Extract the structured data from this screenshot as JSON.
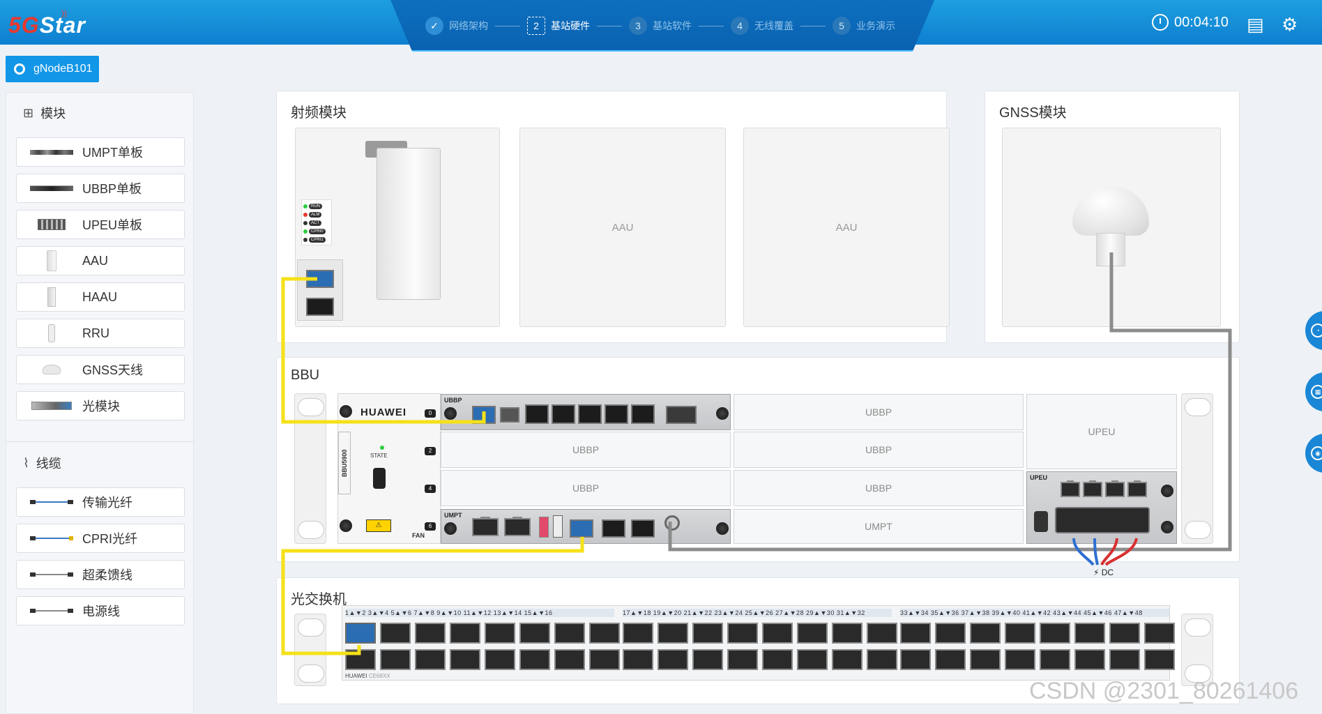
{
  "header": {
    "logo_five": "5G",
    "logo_rest": "Star",
    "steps": [
      {
        "num": "✓",
        "label": "网络架构"
      },
      {
        "num": "2",
        "label": "基站硬件"
      },
      {
        "num": "3",
        "label": "基站软件"
      },
      {
        "num": "4",
        "label": "无线覆盖"
      },
      {
        "num": "5",
        "label": "业务演示"
      }
    ],
    "timer": "00:04:10",
    "active_step": 2
  },
  "node_tab": {
    "label": "gNodeB101"
  },
  "sidebar": {
    "modules_title": "模块",
    "modules": [
      {
        "label": "UMPT单板",
        "icon": "umpt-board-icon"
      },
      {
        "label": "UBBP单板",
        "icon": "ubbp-board-icon"
      },
      {
        "label": "UPEU单板",
        "icon": "upeu-board-icon"
      },
      {
        "label": "AAU",
        "icon": "aau-icon"
      },
      {
        "label": "HAAU",
        "icon": "haau-icon"
      },
      {
        "label": "RRU",
        "icon": "rru-icon"
      },
      {
        "label": "GNSS天线",
        "icon": "gnss-antenna-icon"
      },
      {
        "label": "光模块",
        "icon": "optical-module-icon"
      }
    ],
    "cables_title": "线缆",
    "cables": [
      {
        "label": "传输光纤",
        "icon": "transmission-fiber-icon"
      },
      {
        "label": "CPRI光纤",
        "icon": "cpri-fiber-icon"
      },
      {
        "label": "超柔馈线",
        "icon": "feeder-cable-icon"
      },
      {
        "label": "电源线",
        "icon": "power-cable-icon"
      }
    ]
  },
  "rf": {
    "title": "射频模块",
    "slots": [
      "AAU",
      "AAU"
    ],
    "leds": [
      "RUN",
      "ALM",
      "ACT",
      "CPRI0",
      "CPRI1"
    ]
  },
  "gnss": {
    "title": "GNSS模块"
  },
  "bbu": {
    "title": "BBU",
    "brand": "HUAWEI",
    "model": "BBU5900",
    "state_label": "STATE",
    "fan_label": "FAN",
    "slot_numbers": [
      "0",
      "2",
      "4",
      "6"
    ],
    "ubbp_tag": "UBBP",
    "umpt_tag": "UMPT",
    "upeu_tag": "UPEU",
    "empty_slots": {
      "s1": "UBBP",
      "s2": "UBBP",
      "s3": "UBBP",
      "s4": "UBBP",
      "s5": "UBBP",
      "s6": "UMPT",
      "upeu": "UPEU"
    },
    "umpt_ports": [
      "FE/GE0",
      "FE/GE1",
      "USB",
      "CLK",
      "GNSS"
    ],
    "dc_label": "DC"
  },
  "switch": {
    "title": "光交换机",
    "brand": "HUAWEI",
    "model": "CE68XX",
    "groups": [
      "1▲▼2  3▲▼4  5▲▼6  7▲▼8  9▲▼10 11▲▼12 13▲▼14 15▲▼16",
      "17▲▼18 19▲▼20 21▲▼22 23▲▼24 25▲▼26 27▲▼28 29▲▼30 31▲▼32",
      "33▲▼34 35▲▼36 37▲▼38 39▲▼40 41▲▼42 43▲▼44 45▲▼46 47▲▼48"
    ]
  },
  "watermark": "CSDN @2301_80261406",
  "colors": {
    "header": "#1493dd",
    "accent": "#1196e8",
    "cpri_fiber": "#f5e11a",
    "gnss_cable": "#8c8c8c"
  }
}
